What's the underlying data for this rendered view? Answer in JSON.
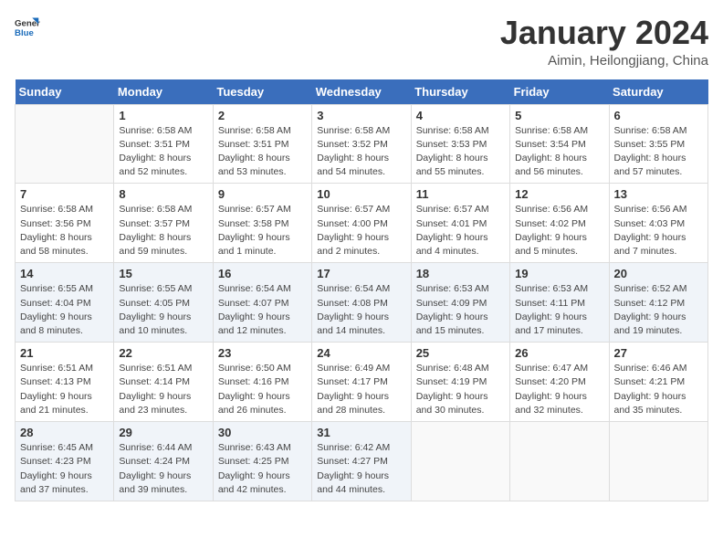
{
  "header": {
    "logo_general": "General",
    "logo_blue": "Blue",
    "month_title": "January 2024",
    "location": "Aimin, Heilongjiang, China"
  },
  "days_of_week": [
    "Sunday",
    "Monday",
    "Tuesday",
    "Wednesday",
    "Thursday",
    "Friday",
    "Saturday"
  ],
  "weeks": [
    [
      {
        "day": "",
        "info": ""
      },
      {
        "day": "1",
        "info": "Sunrise: 6:58 AM\nSunset: 3:51 PM\nDaylight: 8 hours\nand 52 minutes."
      },
      {
        "day": "2",
        "info": "Sunrise: 6:58 AM\nSunset: 3:51 PM\nDaylight: 8 hours\nand 53 minutes."
      },
      {
        "day": "3",
        "info": "Sunrise: 6:58 AM\nSunset: 3:52 PM\nDaylight: 8 hours\nand 54 minutes."
      },
      {
        "day": "4",
        "info": "Sunrise: 6:58 AM\nSunset: 3:53 PM\nDaylight: 8 hours\nand 55 minutes."
      },
      {
        "day": "5",
        "info": "Sunrise: 6:58 AM\nSunset: 3:54 PM\nDaylight: 8 hours\nand 56 minutes."
      },
      {
        "day": "6",
        "info": "Sunrise: 6:58 AM\nSunset: 3:55 PM\nDaylight: 8 hours\nand 57 minutes."
      }
    ],
    [
      {
        "day": "7",
        "info": "Sunrise: 6:58 AM\nSunset: 3:56 PM\nDaylight: 8 hours\nand 58 minutes."
      },
      {
        "day": "8",
        "info": "Sunrise: 6:58 AM\nSunset: 3:57 PM\nDaylight: 8 hours\nand 59 minutes."
      },
      {
        "day": "9",
        "info": "Sunrise: 6:57 AM\nSunset: 3:58 PM\nDaylight: 9 hours\nand 1 minute."
      },
      {
        "day": "10",
        "info": "Sunrise: 6:57 AM\nSunset: 4:00 PM\nDaylight: 9 hours\nand 2 minutes."
      },
      {
        "day": "11",
        "info": "Sunrise: 6:57 AM\nSunset: 4:01 PM\nDaylight: 9 hours\nand 4 minutes."
      },
      {
        "day": "12",
        "info": "Sunrise: 6:56 AM\nSunset: 4:02 PM\nDaylight: 9 hours\nand 5 minutes."
      },
      {
        "day": "13",
        "info": "Sunrise: 6:56 AM\nSunset: 4:03 PM\nDaylight: 9 hours\nand 7 minutes."
      }
    ],
    [
      {
        "day": "14",
        "info": "Sunrise: 6:55 AM\nSunset: 4:04 PM\nDaylight: 9 hours\nand 8 minutes."
      },
      {
        "day": "15",
        "info": "Sunrise: 6:55 AM\nSunset: 4:05 PM\nDaylight: 9 hours\nand 10 minutes."
      },
      {
        "day": "16",
        "info": "Sunrise: 6:54 AM\nSunset: 4:07 PM\nDaylight: 9 hours\nand 12 minutes."
      },
      {
        "day": "17",
        "info": "Sunrise: 6:54 AM\nSunset: 4:08 PM\nDaylight: 9 hours\nand 14 minutes."
      },
      {
        "day": "18",
        "info": "Sunrise: 6:53 AM\nSunset: 4:09 PM\nDaylight: 9 hours\nand 15 minutes."
      },
      {
        "day": "19",
        "info": "Sunrise: 6:53 AM\nSunset: 4:11 PM\nDaylight: 9 hours\nand 17 minutes."
      },
      {
        "day": "20",
        "info": "Sunrise: 6:52 AM\nSunset: 4:12 PM\nDaylight: 9 hours\nand 19 minutes."
      }
    ],
    [
      {
        "day": "21",
        "info": "Sunrise: 6:51 AM\nSunset: 4:13 PM\nDaylight: 9 hours\nand 21 minutes."
      },
      {
        "day": "22",
        "info": "Sunrise: 6:51 AM\nSunset: 4:14 PM\nDaylight: 9 hours\nand 23 minutes."
      },
      {
        "day": "23",
        "info": "Sunrise: 6:50 AM\nSunset: 4:16 PM\nDaylight: 9 hours\nand 26 minutes."
      },
      {
        "day": "24",
        "info": "Sunrise: 6:49 AM\nSunset: 4:17 PM\nDaylight: 9 hours\nand 28 minutes."
      },
      {
        "day": "25",
        "info": "Sunrise: 6:48 AM\nSunset: 4:19 PM\nDaylight: 9 hours\nand 30 minutes."
      },
      {
        "day": "26",
        "info": "Sunrise: 6:47 AM\nSunset: 4:20 PM\nDaylight: 9 hours\nand 32 minutes."
      },
      {
        "day": "27",
        "info": "Sunrise: 6:46 AM\nSunset: 4:21 PM\nDaylight: 9 hours\nand 35 minutes."
      }
    ],
    [
      {
        "day": "28",
        "info": "Sunrise: 6:45 AM\nSunset: 4:23 PM\nDaylight: 9 hours\nand 37 minutes."
      },
      {
        "day": "29",
        "info": "Sunrise: 6:44 AM\nSunset: 4:24 PM\nDaylight: 9 hours\nand 39 minutes."
      },
      {
        "day": "30",
        "info": "Sunrise: 6:43 AM\nSunset: 4:25 PM\nDaylight: 9 hours\nand 42 minutes."
      },
      {
        "day": "31",
        "info": "Sunrise: 6:42 AM\nSunset: 4:27 PM\nDaylight: 9 hours\nand 44 minutes."
      },
      {
        "day": "",
        "info": ""
      },
      {
        "day": "",
        "info": ""
      },
      {
        "day": "",
        "info": ""
      }
    ]
  ]
}
